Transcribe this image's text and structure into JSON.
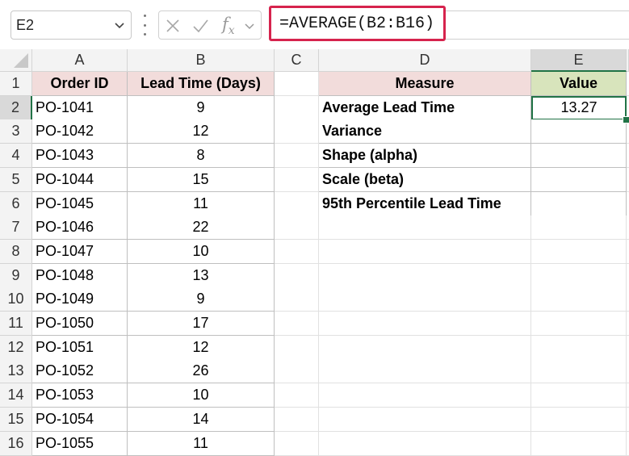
{
  "name_box": {
    "value": "E2"
  },
  "formula_bar": {
    "fx_label": "fx",
    "formula": "=AVERAGE(B2:B16)"
  },
  "columns": [
    "A",
    "B",
    "C",
    "D",
    "E"
  ],
  "selected_column": "E",
  "selected_row": "2",
  "rows": [
    "1",
    "2",
    "3",
    "4",
    "5",
    "6",
    "7",
    "8",
    "9",
    "10",
    "11",
    "12",
    "13",
    "14",
    "15",
    "16"
  ],
  "table1": {
    "headers": {
      "order_id": "Order ID",
      "lead_time": "Lead Time (Days)"
    },
    "records": [
      {
        "order_id": "PO-1041",
        "lead_time": "9"
      },
      {
        "order_id": "PO-1042",
        "lead_time": "12"
      },
      {
        "order_id": "PO-1043",
        "lead_time": "8"
      },
      {
        "order_id": "PO-1044",
        "lead_time": "15"
      },
      {
        "order_id": "PO-1045",
        "lead_time": "11"
      },
      {
        "order_id": "PO-1046",
        "lead_time": "22"
      },
      {
        "order_id": "PO-1047",
        "lead_time": "10"
      },
      {
        "order_id": "PO-1048",
        "lead_time": "13"
      },
      {
        "order_id": "PO-1049",
        "lead_time": "9"
      },
      {
        "order_id": "PO-1050",
        "lead_time": "17"
      },
      {
        "order_id": "PO-1051",
        "lead_time": "12"
      },
      {
        "order_id": "PO-1052",
        "lead_time": "26"
      },
      {
        "order_id": "PO-1053",
        "lead_time": "10"
      },
      {
        "order_id": "PO-1054",
        "lead_time": "14"
      },
      {
        "order_id": "PO-1055",
        "lead_time": "11"
      }
    ]
  },
  "table2": {
    "headers": {
      "measure": "Measure",
      "value": "Value"
    },
    "records": [
      {
        "measure": "Average Lead Time",
        "value": "13.27"
      },
      {
        "measure": "Variance",
        "value": ""
      },
      {
        "measure": "Shape (alpha)",
        "value": ""
      },
      {
        "measure": "Scale (beta)",
        "value": ""
      },
      {
        "measure": "95th Percentile Lead Time",
        "value": ""
      }
    ]
  },
  "colors": {
    "accent": "#217346",
    "formula_highlight": "#d6234d",
    "header_pink": "#f2dcdb",
    "header_green": "#d8e4bc"
  }
}
